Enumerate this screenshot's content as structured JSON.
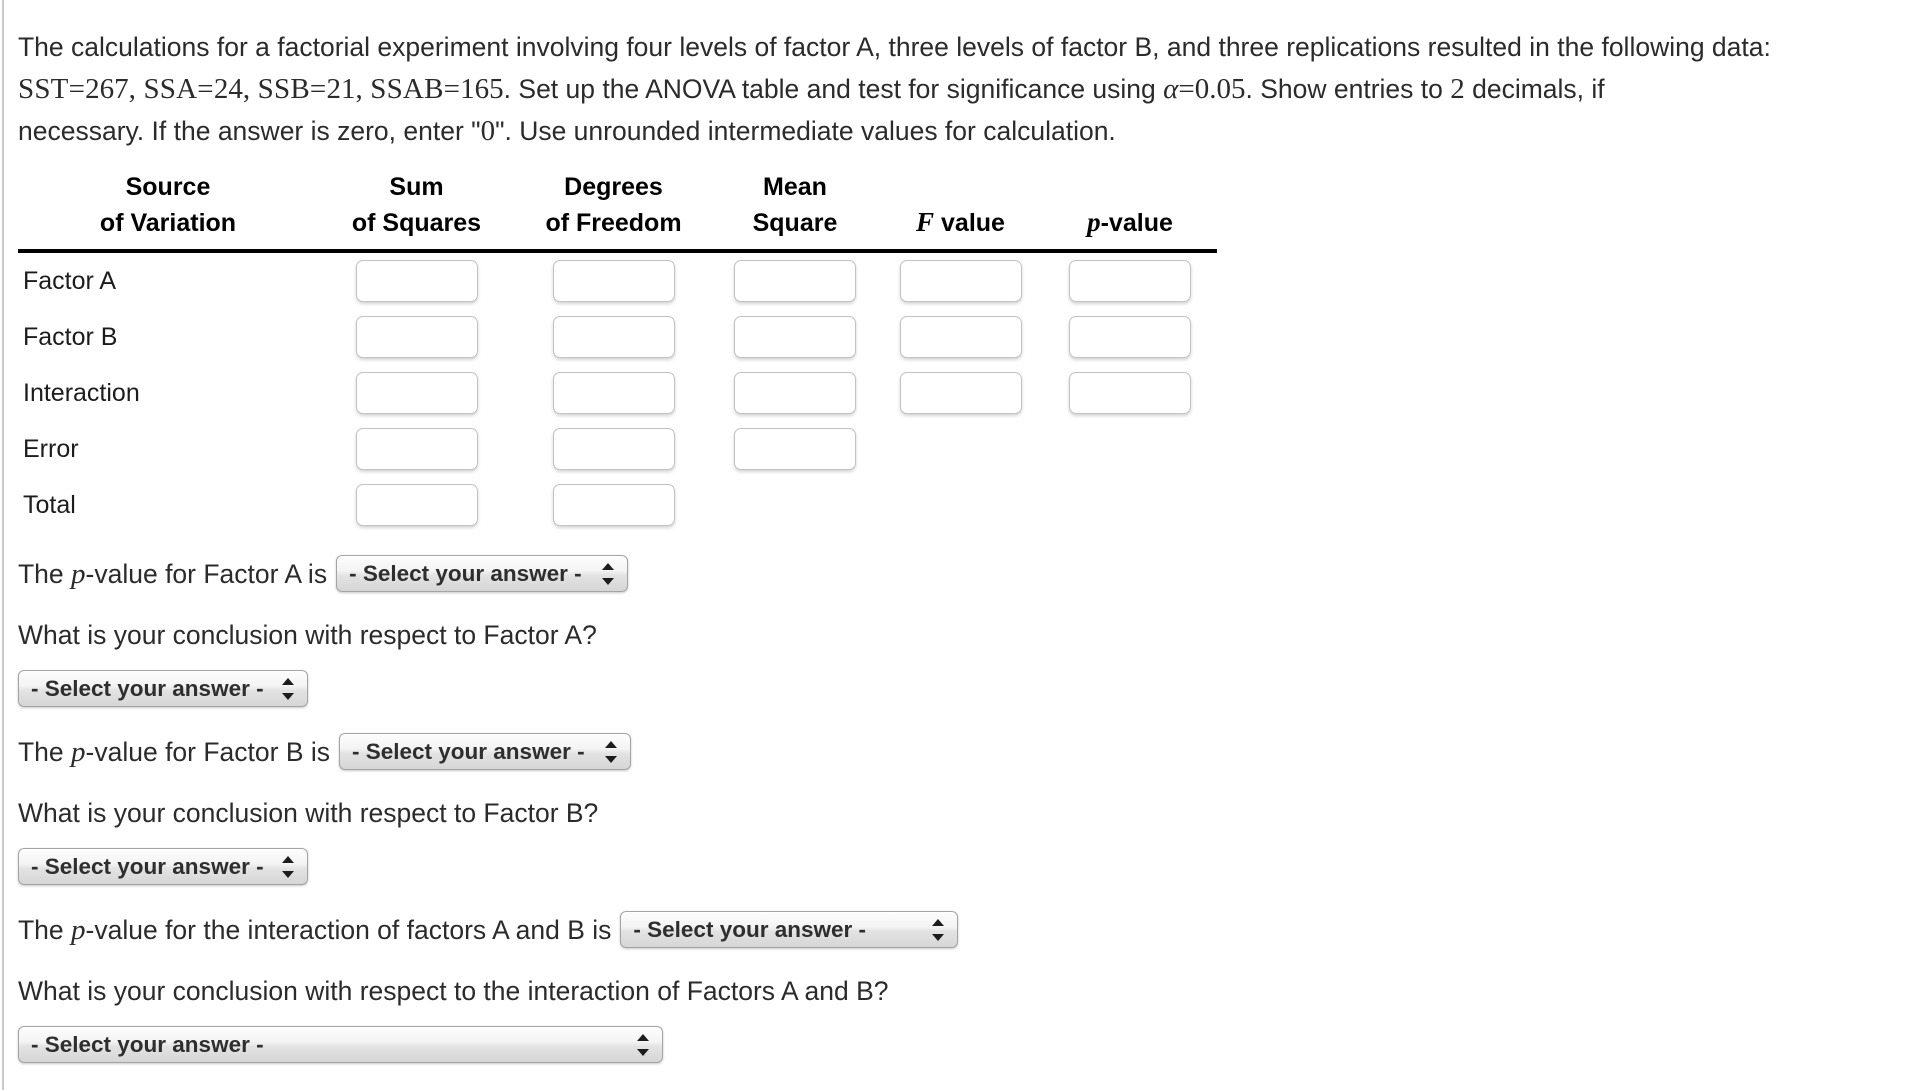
{
  "problem": {
    "line1_pre": "The calculations for a factorial experiment involving four levels of factor A, three levels of factor B, and three replications resulted in the following data:",
    "sst_label": "SST",
    "sst_value": "267",
    "ssa_label": "SSA",
    "ssa_value": "24",
    "ssb_label": "SSB",
    "ssb_value": "21",
    "ssab_label": "SSAB",
    "ssab_value": "165",
    "line2_mid": ". Set up the ANOVA table and test for significance using ",
    "alpha_symbol": "α",
    "equals": "=",
    "alpha_value": "0.05",
    "line2_post": ". Show entries to ",
    "decimals": "2",
    "line2_end": " decimals, if",
    "line3_pre": "necessary. If the answer is zero, enter \"",
    "zero": "0",
    "line3_post": "\". Use unrounded intermediate values for calculation.",
    "comma": ",",
    "period": "."
  },
  "table": {
    "headers_top": {
      "source": "Source",
      "sum": "Sum",
      "degrees": "Degrees",
      "mean": "Mean",
      "f": "",
      "p": ""
    },
    "headers_bottom": {
      "source": "of Variation",
      "sum": "of Squares",
      "degrees": "of Freedom",
      "mean": "Square",
      "f_italic": "F",
      "f_rest": " value",
      "p_italic": "p",
      "p_rest": "-value"
    },
    "rows": [
      {
        "label": "Factor A",
        "inputs": [
          "",
          "",
          "",
          "",
          ""
        ],
        "input_count": 5
      },
      {
        "label": "Factor B",
        "inputs": [
          "",
          "",
          "",
          "",
          ""
        ],
        "input_count": 5
      },
      {
        "label": "Interaction",
        "inputs": [
          "",
          "",
          "",
          "",
          ""
        ],
        "input_count": 5
      },
      {
        "label": "Error",
        "inputs": [
          "",
          "",
          ""
        ],
        "input_count": 3
      },
      {
        "label": "Total",
        "inputs": [
          "",
          ""
        ],
        "input_count": 2
      }
    ],
    "input_placeholder": ""
  },
  "questions": {
    "select_default": "- Select your answer -",
    "pvalue_a_pre": "The ",
    "pvalue_a_italic": "p",
    "pvalue_a_post": "-value for Factor A is",
    "conclusion_a": "What is your conclusion with respect to Factor A?",
    "pvalue_b_pre": "The ",
    "pvalue_b_italic": "p",
    "pvalue_b_post": "-value for Factor B is",
    "conclusion_b": "What is your conclusion with respect to Factor B?",
    "pvalue_ab_pre": "The ",
    "pvalue_ab_italic": "p",
    "pvalue_ab_post": "-value for the interaction of factors A and B is",
    "conclusion_ab": "What is your conclusion with respect to the interaction of Factors A and B?"
  },
  "colors": {
    "page_bg": "#ffffff",
    "text": "#2b2b2b",
    "rule": "#000000",
    "input_border": "#c2c2c2",
    "select_border": "#a4a4a4",
    "left_edge": "#c9c9c9"
  }
}
